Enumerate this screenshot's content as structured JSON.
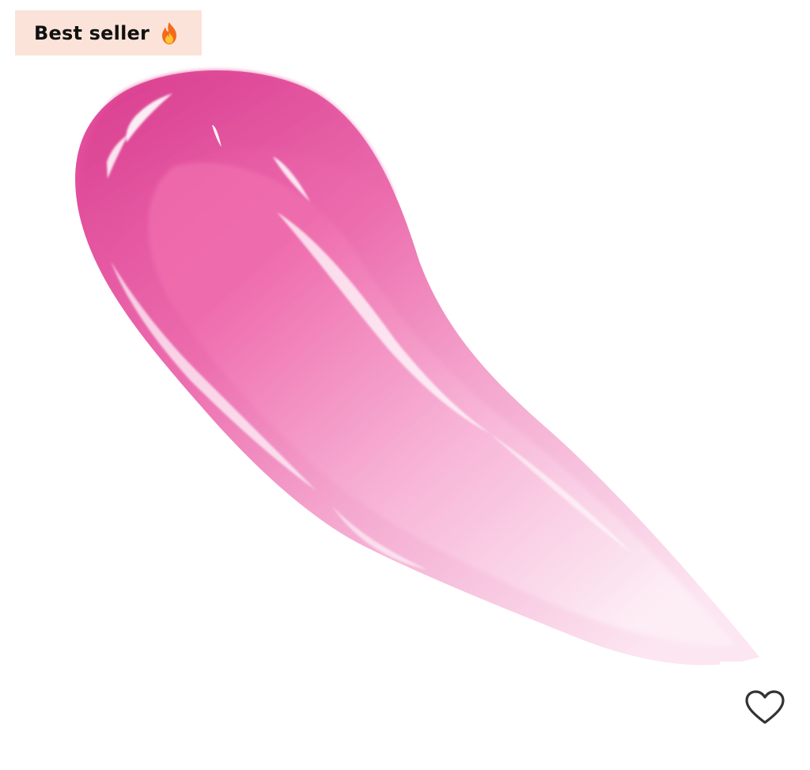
{
  "badge": {
    "label": "Best seller",
    "icon": "fire-icon",
    "background_color": "#FBE3D9",
    "text_color": "#111111"
  },
  "product_image": {
    "description_icon": "lip-gloss-swatch",
    "primary_color": "#E4449A",
    "highlight_color": "#F7C8E0"
  },
  "wishlist": {
    "icon": "heart-outline-icon",
    "stroke_color": "#333333"
  }
}
